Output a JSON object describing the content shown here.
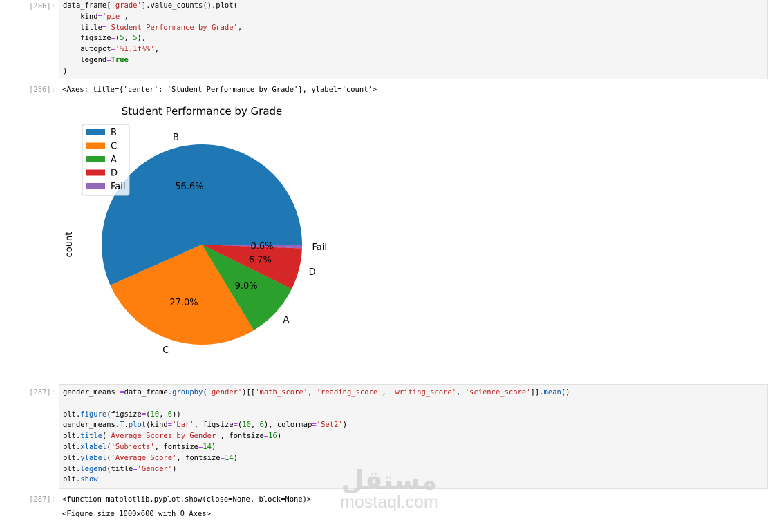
{
  "cells": [
    {
      "in_prompt": "[286]:",
      "out_prompt": "[286]:",
      "code": [
        [
          [
            "",
            "data_frame["
          ],
          [
            "s",
            "'grade'"
          ],
          [
            "",
            "].value_counts().plot("
          ]
        ],
        [
          [
            "",
            "    kind"
          ],
          [
            "o",
            "="
          ],
          [
            "s",
            "'pie'"
          ],
          [
            "",
            ","
          ]
        ],
        [
          [
            "",
            "    title"
          ],
          [
            "o",
            "="
          ],
          [
            "s",
            "'Student Performance by Grade'"
          ],
          [
            "",
            ","
          ]
        ],
        [
          [
            "",
            "    figsize"
          ],
          [
            "o",
            "="
          ],
          [
            "",
            "("
          ],
          [
            "n",
            "5"
          ],
          [
            "",
            ", "
          ],
          [
            "n",
            "5"
          ],
          [
            "",
            "),"
          ]
        ],
        [
          [
            "",
            "    autopct"
          ],
          [
            "o",
            "="
          ],
          [
            "s",
            "'%1.1f%%'"
          ],
          [
            "",
            ","
          ]
        ],
        [
          [
            "",
            "    legend"
          ],
          [
            "o",
            "="
          ],
          [
            "k",
            "True"
          ]
        ],
        [
          [
            "",
            ")"
          ]
        ]
      ],
      "outputs": [
        "<Axes: title={'center': 'Student Performance by Grade'}, ylabel='count'>"
      ]
    },
    {
      "in_prompt": "[287]:",
      "out_prompt": "[287]:",
      "code": [
        [
          [
            "",
            "gender_means "
          ],
          [
            "o",
            "="
          ],
          [
            "",
            "data_frame."
          ],
          [
            "p",
            "groupby"
          ],
          [
            "",
            "("
          ],
          [
            "s",
            "'gender'"
          ],
          [
            "",
            ")[["
          ],
          [
            "s",
            "'math_score'"
          ],
          [
            "",
            ", "
          ],
          [
            "s",
            "'reading_score'"
          ],
          [
            "",
            ", "
          ],
          [
            "s",
            "'writing_score'"
          ],
          [
            "",
            ", "
          ],
          [
            "s",
            "'science_score'"
          ],
          [
            "",
            "]]."
          ],
          [
            "p",
            "mean"
          ],
          [
            "",
            "()"
          ]
        ],
        [
          [
            "",
            ""
          ]
        ],
        [
          [
            "",
            "plt."
          ],
          [
            "p",
            "figure"
          ],
          [
            "",
            "(figsize"
          ],
          [
            "o",
            "="
          ],
          [
            "",
            "("
          ],
          [
            "n",
            "10"
          ],
          [
            "",
            ", "
          ],
          [
            "n",
            "6"
          ],
          [
            "",
            "))"
          ]
        ],
        [
          [
            "",
            "gender_means."
          ],
          [
            "p",
            "T"
          ],
          [
            "",
            "."
          ],
          [
            "p",
            "plot"
          ],
          [
            "",
            "(kind"
          ],
          [
            "o",
            "="
          ],
          [
            "s",
            "'bar'"
          ],
          [
            "",
            ", figsize"
          ],
          [
            "o",
            "="
          ],
          [
            "",
            "("
          ],
          [
            "n",
            "10"
          ],
          [
            "",
            ", "
          ],
          [
            "n",
            "6"
          ],
          [
            "",
            "), colormap"
          ],
          [
            "o",
            "="
          ],
          [
            "s",
            "'Set2'"
          ],
          [
            "",
            ")"
          ]
        ],
        [
          [
            "",
            "plt."
          ],
          [
            "p",
            "title"
          ],
          [
            "",
            "("
          ],
          [
            "s",
            "'Average Scores by Gender'"
          ],
          [
            "",
            ", fontsize"
          ],
          [
            "o",
            "="
          ],
          [
            "n",
            "16"
          ],
          [
            "",
            ")"
          ]
        ],
        [
          [
            "",
            "plt."
          ],
          [
            "p",
            "xlabel"
          ],
          [
            "",
            "("
          ],
          [
            "s",
            "'Subjects'"
          ],
          [
            "",
            ", fontsize"
          ],
          [
            "o",
            "="
          ],
          [
            "n",
            "14"
          ],
          [
            "",
            ")"
          ]
        ],
        [
          [
            "",
            "plt."
          ],
          [
            "p",
            "ylabel"
          ],
          [
            "",
            "("
          ],
          [
            "s",
            "'Average Score'"
          ],
          [
            "",
            ", fontsize"
          ],
          [
            "o",
            "="
          ],
          [
            "n",
            "14"
          ],
          [
            "",
            ")"
          ]
        ],
        [
          [
            "",
            "plt."
          ],
          [
            "p",
            "legend"
          ],
          [
            "",
            "(title"
          ],
          [
            "o",
            "="
          ],
          [
            "s",
            "'Gender'"
          ],
          [
            "",
            ")"
          ]
        ],
        [
          [
            "",
            "plt."
          ],
          [
            "p",
            "show"
          ]
        ]
      ],
      "outputs": [
        "<function matplotlib.pyplot.show(close=None, block=None)>",
        "<Figure size 1000x600 with 0 Axes>"
      ]
    }
  ],
  "chart_data": {
    "type": "pie",
    "title": "Student Performance by Grade",
    "ylabel": "count",
    "categories": [
      "B",
      "C",
      "A",
      "D",
      "Fail"
    ],
    "values": [
      56.6,
      27.0,
      9.0,
      6.7,
      0.6
    ],
    "pct_labels": [
      "56.6%",
      "27.0%",
      "9.0%",
      "6.7%",
      "0.6%"
    ],
    "colors": [
      "#1f77b4",
      "#ff7f0e",
      "#2ca02c",
      "#d62728",
      "#9467bd"
    ],
    "start_angle": 0,
    "legend": "upper-left"
  },
  "watermark": {
    "arabic": "مستقل",
    "latin": "mostaql.com"
  }
}
